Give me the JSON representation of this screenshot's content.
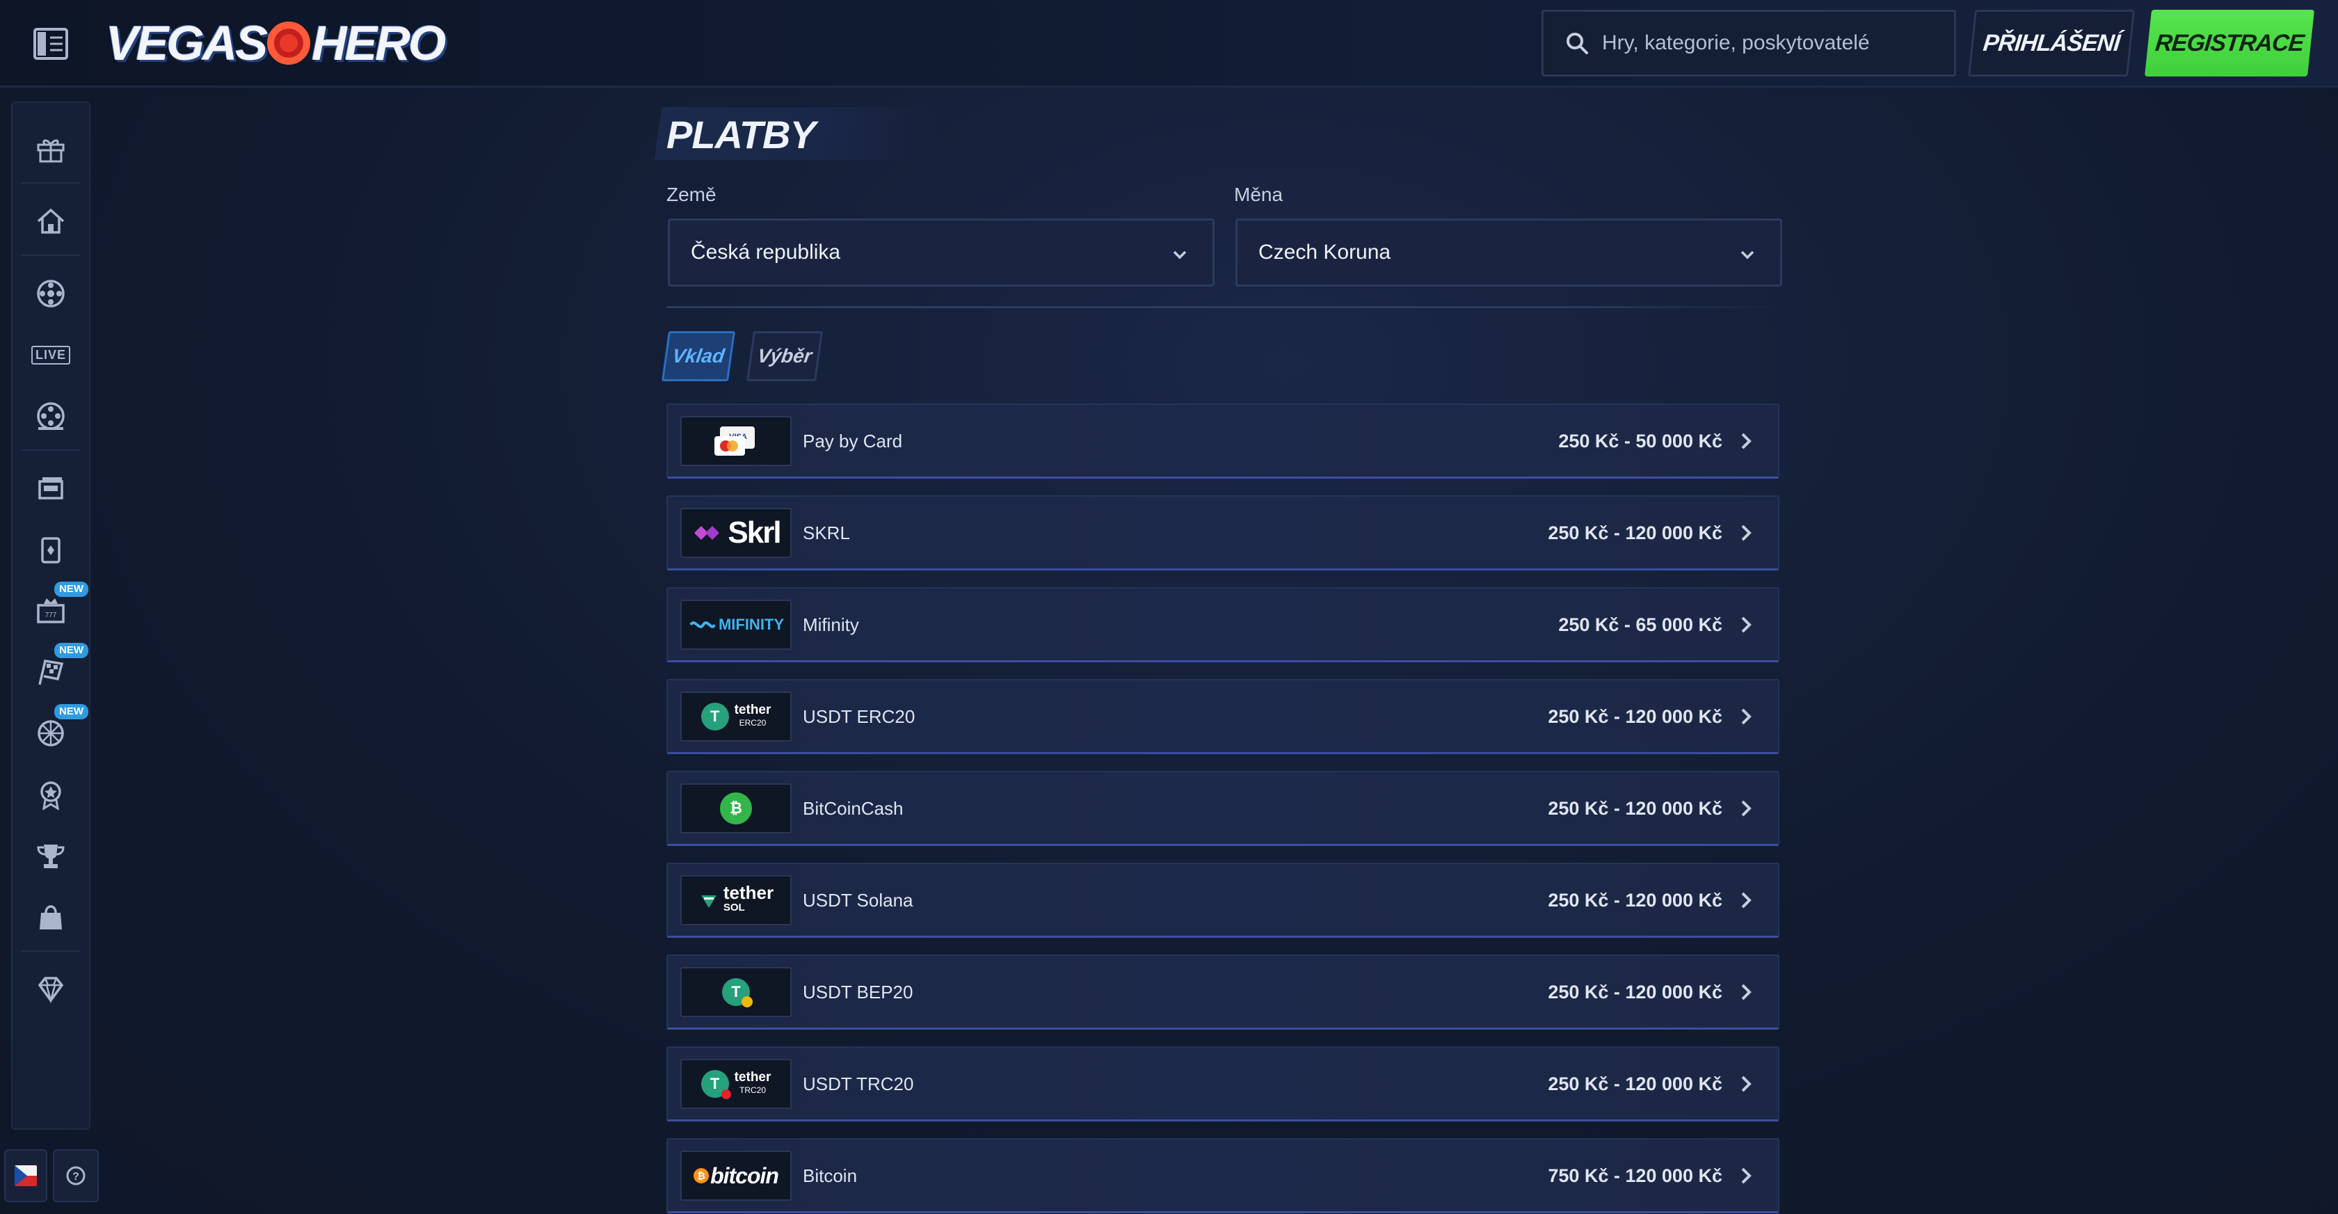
{
  "header": {
    "logo_text_left": "VEGAS",
    "logo_text_right": "HERO",
    "search_placeholder": "Hry, kategorie, poskytovatelé",
    "login_label": "PŘIHLÁŠENÍ",
    "register_label": "REGISTRACE"
  },
  "sidebar": {
    "items": [
      {
        "icon": "gift-icon"
      },
      {
        "icon": "home-icon"
      },
      {
        "icon": "slots-icon"
      },
      {
        "icon": "live-icon",
        "text": "LIVE"
      },
      {
        "icon": "film-reel-icon"
      },
      {
        "icon": "megaways-icon"
      },
      {
        "icon": "cards-icon"
      },
      {
        "icon": "jackpot-icon",
        "badge": "NEW"
      },
      {
        "icon": "racing-flag-icon",
        "badge": "NEW"
      },
      {
        "icon": "sports-ball-icon",
        "badge": "NEW"
      },
      {
        "icon": "award-icon"
      },
      {
        "icon": "trophy-icon"
      },
      {
        "icon": "shop-icon"
      },
      {
        "icon": "diamond-icon"
      }
    ]
  },
  "page": {
    "title": "PLATBY",
    "country_label": "Země",
    "country_value": "Česká republika",
    "currency_label": "Měna",
    "currency_value": "Czech Koruna",
    "tab_deposit": "Vklad",
    "tab_withdraw": "Výběr"
  },
  "methods": [
    {
      "name": "Pay by Card",
      "range": "250 Kč - 50 000 Kč",
      "logo": "card"
    },
    {
      "name": "SKRL",
      "range": "250 Kč - 120 000 Kč",
      "logo": "skrill",
      "logo_text": "Skrl"
    },
    {
      "name": "Mifinity",
      "range": "250 Kč - 65 000 Kč",
      "logo": "mifinity",
      "logo_text": "MIFINITY"
    },
    {
      "name": "USDT ERC20",
      "range": "250 Kč - 120 000 Kč",
      "logo": "tether-erc",
      "logo_text": "tether",
      "logo_sub": "ERC20"
    },
    {
      "name": "BitCoinCash",
      "range": "250 Kč - 120 000 Kč",
      "logo": "bch"
    },
    {
      "name": "USDT Solana",
      "range": "250 Kč - 120 000 Kč",
      "logo": "tether-sol",
      "logo_text": "tether",
      "logo_sub": "SOL"
    },
    {
      "name": "USDT BEP20",
      "range": "250 Kč - 120 000 Kč",
      "logo": "tether-bep"
    },
    {
      "name": "USDT TRC20",
      "range": "250 Kč - 120 000 Kč",
      "logo": "tether-trc",
      "logo_text": "tether",
      "logo_sub": "TRC20"
    },
    {
      "name": "Bitcoin",
      "range": "750 Kč - 120 000 Kč",
      "logo": "bitcoin",
      "logo_text": "bitcoin"
    }
  ],
  "colors": {
    "accent_green": "#4fdc47",
    "accent_blue": "#2f9be0",
    "bg": "#111a2e"
  }
}
